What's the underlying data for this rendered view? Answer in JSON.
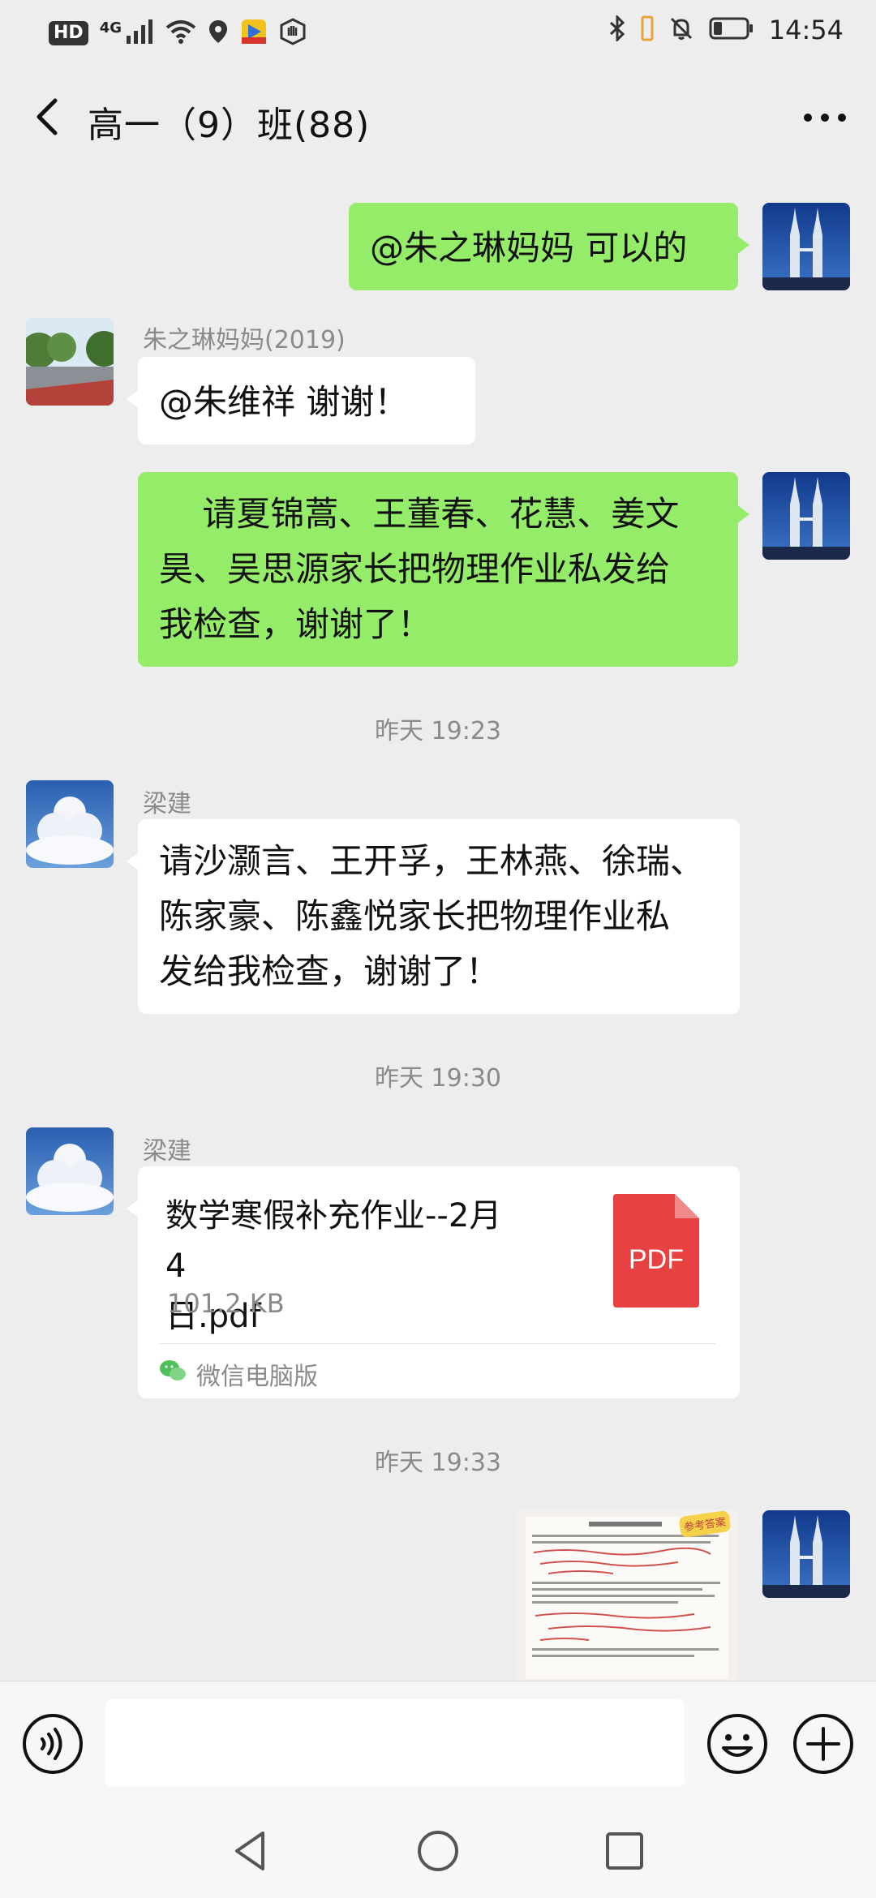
{
  "status_bar": {
    "left_badge": "HD",
    "network_label": "4G",
    "time": "14:54"
  },
  "header": {
    "title": "高一（9）班(88)"
  },
  "messages": [
    {
      "text": "@朱之琳妈妈  可以的"
    },
    {
      "sender": "朱之琳妈妈(2019)",
      "text": "@朱维祥     谢谢！"
    },
    {
      "lines": [
        "    请夏锦蒿、王董春、花慧、姜文",
        "昊、吴思源家长把物理作业私发给",
        "我检查，谢谢了！"
      ]
    },
    {
      "sender": "梁建",
      "lines": [
        "请沙灏言、王开孚，王林燕、徐瑞、",
        "陈家豪、陈鑫悦家长把物理作业私",
        "发给我检查，谢谢了！"
      ]
    },
    {
      "sender": "梁建",
      "file_name_lines": [
        "数学寒假补充作业--2月4",
        "日.pdf"
      ],
      "file_size": "101.2 KB",
      "file_icon_label": "PDF",
      "file_source": "微信电脑版"
    }
  ],
  "timestamps": [
    "昨天 19:23",
    "昨天 19:30",
    "昨天 19:33"
  ],
  "image_message": {
    "sticker_label": "参考答案"
  },
  "colors": {
    "sent_bubble": "#95ec69",
    "received_bubble": "#ffffff",
    "background": "#ededed",
    "pdf_red": "#e84141"
  }
}
